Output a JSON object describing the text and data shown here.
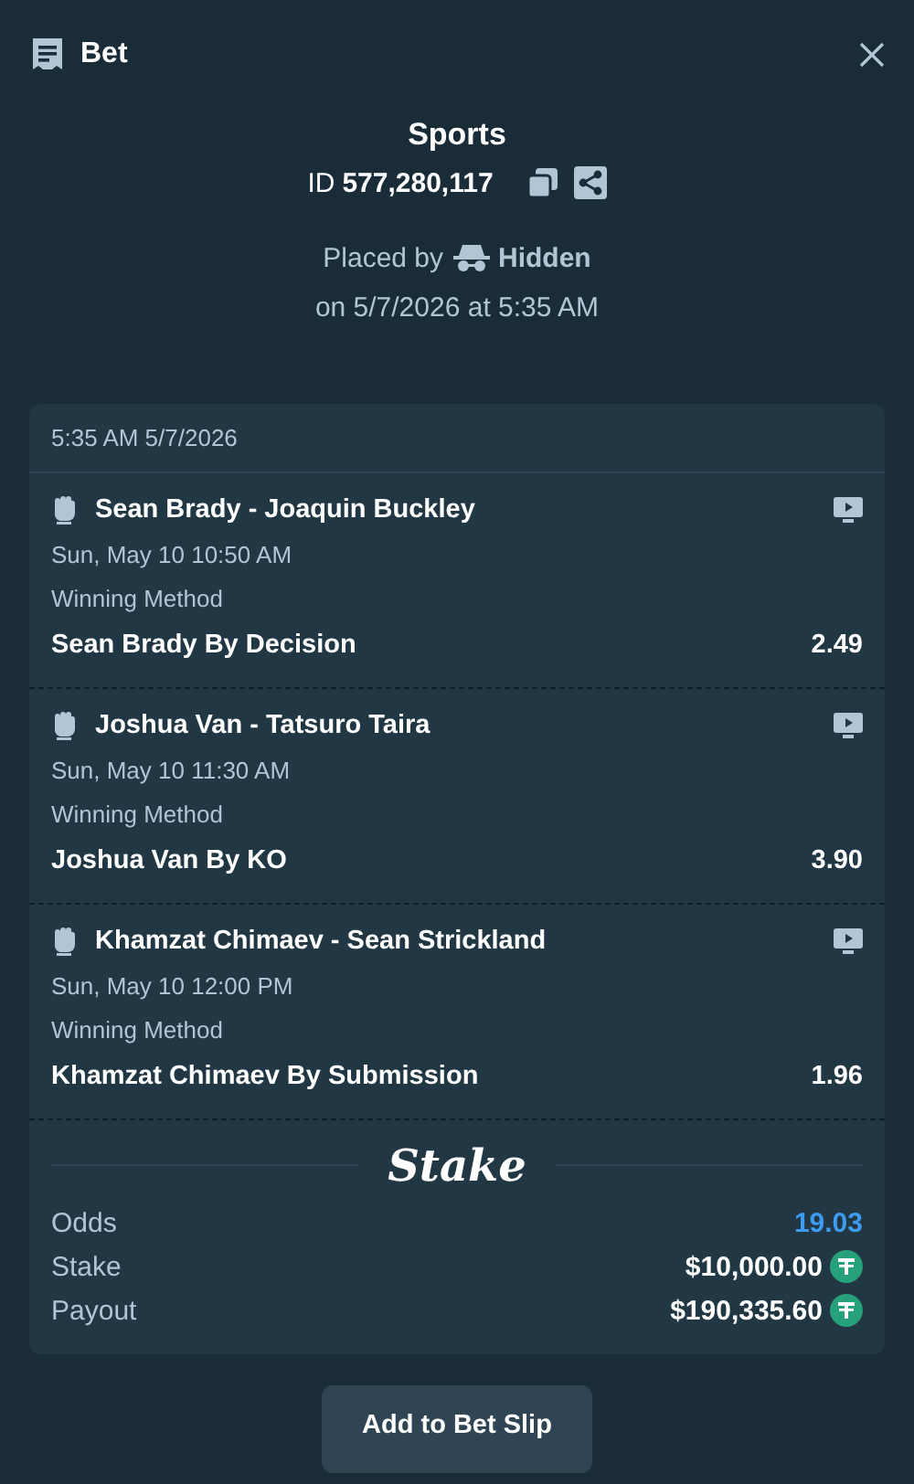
{
  "header": {
    "title": "Bet"
  },
  "bet": {
    "category": "Sports",
    "id_label": "ID",
    "id": "577,280,117",
    "placed_by_label": "Placed by",
    "placed_by": "Hidden",
    "placed_on": "on 5/7/2026 at 5:35 AM"
  },
  "card": {
    "timestamp": "5:35 AM 5/7/2026",
    "legs": [
      {
        "event": "Sean Brady - Joaquin Buckley",
        "date": "Sun, May 10  10:50 AM",
        "market": "Winning Method",
        "selection": "Sean Brady By Decision",
        "odds": "2.49"
      },
      {
        "event": "Joshua Van - Tatsuro Taira",
        "date": "Sun, May 10  11:30 AM",
        "market": "Winning Method",
        "selection": "Joshua Van By KO",
        "odds": "3.90"
      },
      {
        "event": "Khamzat Chimaev - Sean Strickland",
        "date": "Sun, May 10  12:00 PM",
        "market": "Winning Method",
        "selection": "Khamzat Chimaev By Submission",
        "odds": "1.96"
      }
    ],
    "brand": "Stake",
    "summary": [
      {
        "kind": "odds",
        "label": "Odds",
        "value": "19.03"
      },
      {
        "kind": "amount",
        "label": "Stake",
        "value": "$10,000.00"
      },
      {
        "kind": "amount",
        "label": "Payout",
        "value": "$190,335.60"
      }
    ]
  },
  "button": "Add to Bet Slip"
}
